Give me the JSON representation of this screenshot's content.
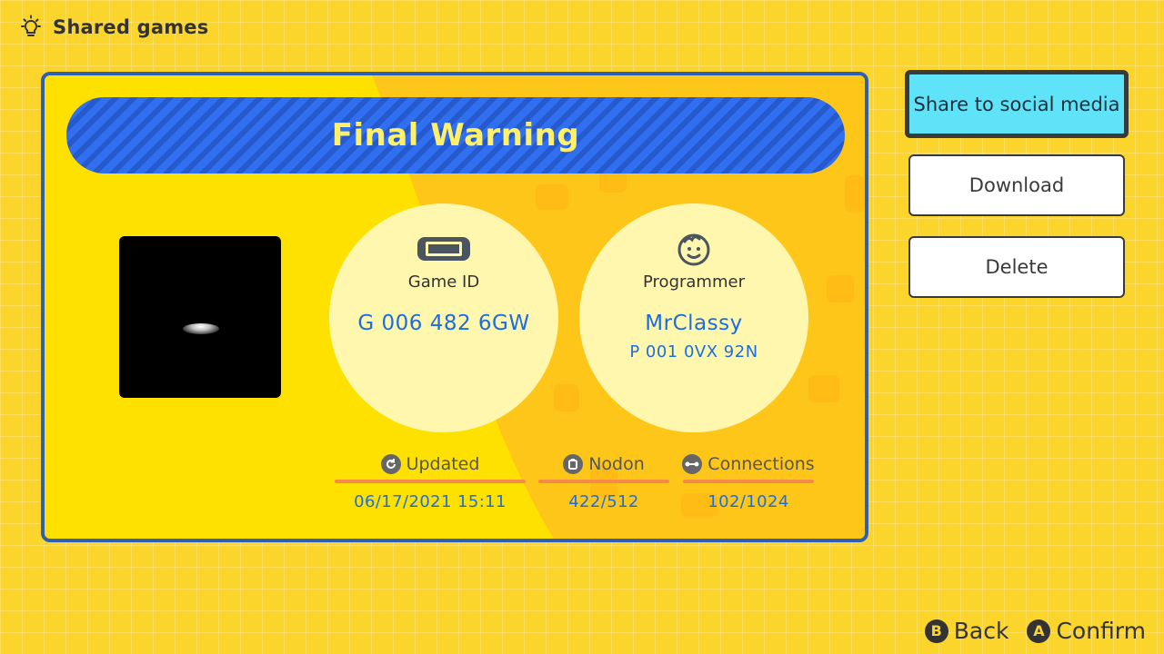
{
  "header": {
    "title": "Shared games",
    "icon": "lightbulb-icon"
  },
  "card": {
    "title": "Final Warning",
    "game_id": {
      "label": "Game ID",
      "value": "G 006 482 6GW",
      "icon": "console-icon"
    },
    "programmer": {
      "label": "Programmer",
      "name": "MrClassy",
      "id": "P 001 0VX 92N",
      "icon": "face-icon"
    },
    "stats": {
      "updated": {
        "label": "Updated",
        "value": "06/17/2021 15:11",
        "icon": "refresh-icon"
      },
      "nodon": {
        "label": "Nodon",
        "value": "422/512",
        "icon": "nodon-icon"
      },
      "connections": {
        "label": "Connections",
        "value": "102/1024",
        "icon": "connection-icon"
      }
    }
  },
  "actions": {
    "share": "Share to social media",
    "download": "Download",
    "delete": "Delete"
  },
  "footer": {
    "back": {
      "key": "B",
      "label": "Back"
    },
    "confirm": {
      "key": "A",
      "label": "Confirm"
    }
  },
  "colors": {
    "background": "#fcd52c",
    "card_border": "#2f5fb0",
    "title_bar": "#2f6ff0",
    "title_text": "#fff06a",
    "value_text": "#1d6de0",
    "share_button": "#5ee3f8",
    "stat_underline": "#f58a4a"
  }
}
